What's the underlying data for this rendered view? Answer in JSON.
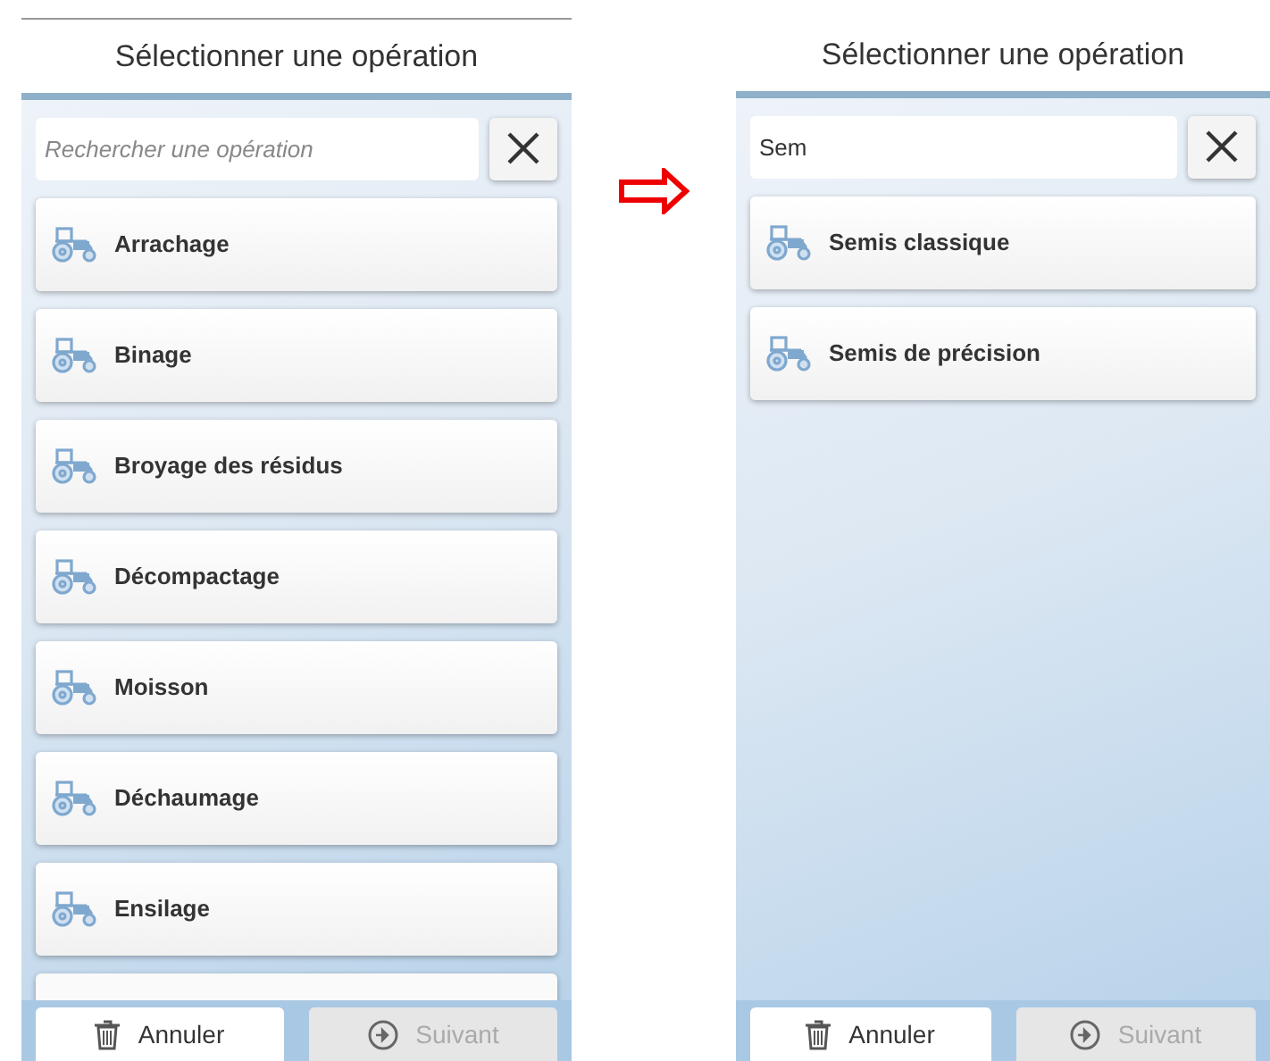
{
  "screens": [
    {
      "title": "Sélectionner une opération",
      "search": {
        "placeholder": "Rechercher une opération"
      },
      "operations": [
        {
          "label": "Arrachage"
        },
        {
          "label": "Binage"
        },
        {
          "label": "Broyage des résidus"
        },
        {
          "label": "Décompactage"
        },
        {
          "label": "Moisson"
        },
        {
          "label": "Déchaumage"
        },
        {
          "label": "Ensilage"
        }
      ],
      "more_below": true,
      "buttons": [
        {
          "kind": "cancel",
          "label": "Annuler",
          "disabled": false
        },
        {
          "kind": "next",
          "label": "Suivant",
          "disabled": true
        }
      ]
    },
    {
      "title": "Sélectionner une opération",
      "search": {
        "value": "Sem"
      },
      "operations": [
        {
          "label": "Semis classique"
        },
        {
          "label": "Semis de précision"
        }
      ],
      "more_below": false,
      "buttons": [
        {
          "kind": "cancel",
          "label": "Annuler",
          "disabled": false
        },
        {
          "kind": "next",
          "label": "Suivant",
          "disabled": true
        }
      ]
    }
  ]
}
